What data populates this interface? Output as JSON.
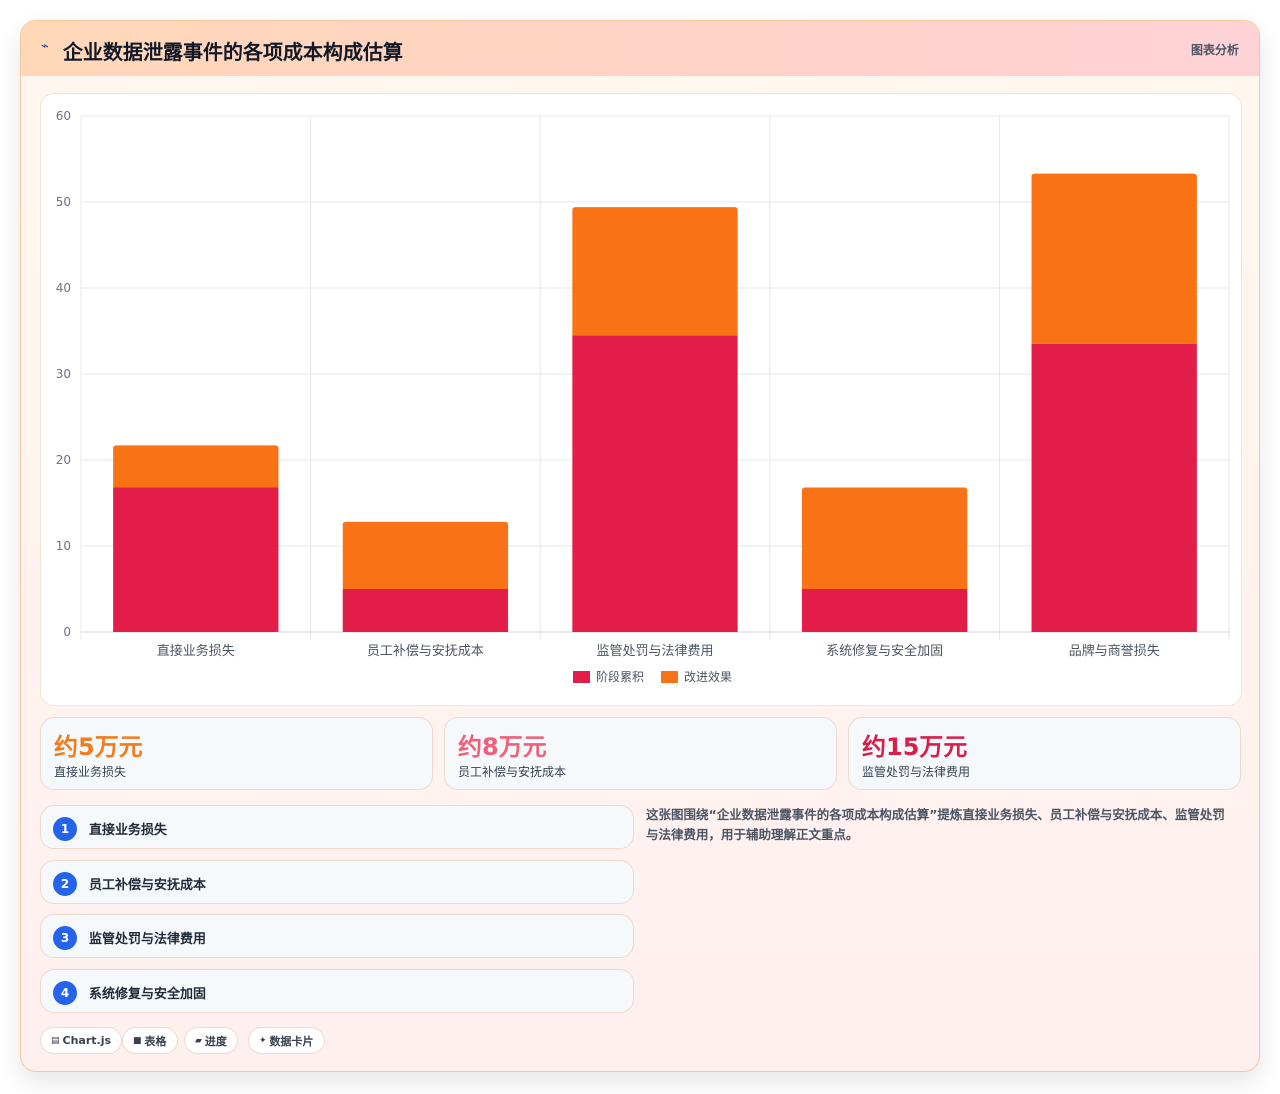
{
  "header": {
    "icon": "chart-icon",
    "title": "企业数据泄露事件的各项成本构成估算",
    "tag": "图表分析"
  },
  "chart_data": {
    "type": "bar",
    "stacked": true,
    "categories": [
      "直接业务损失",
      "员工补偿与安抚成本",
      "监管处罚与法律费用",
      "系统修复与安全加固",
      "品牌与商誉损失"
    ],
    "series": [
      {
        "name": "阶段累积",
        "values": [
          16.8,
          5,
          34.5,
          5,
          33.5
        ],
        "color": "#e11d48"
      },
      {
        "name": "改进效果",
        "values": [
          4.9,
          7.8,
          14.9,
          11.8,
          19.8
        ],
        "color": "#f97316"
      }
    ],
    "ylim": [
      0,
      60
    ],
    "yticks": [
      0,
      10,
      20,
      30,
      40,
      50,
      60
    ],
    "grid": true,
    "legend_position": "bottom"
  },
  "stats": [
    {
      "value": "约5万元",
      "label": "直接业务损失",
      "color": "#f07c1e"
    },
    {
      "value": "约8万元",
      "label": "员工补偿与安抚成本",
      "color": "#f0607a"
    },
    {
      "value": "约15万元",
      "label": "监管处罚与法律费用",
      "color": "#d91e4a"
    }
  ],
  "steps": [
    {
      "num": "1",
      "label": "直接业务损失"
    },
    {
      "num": "2",
      "label": "员工补偿与安抚成本"
    },
    {
      "num": "3",
      "label": "监管处罚与法律费用"
    },
    {
      "num": "4",
      "label": "系统修复与安全加固"
    }
  ],
  "description": "这张图围绕“企业数据泄露事件的各项成本构成估算”提炼直接业务损失、员工补偿与安抚成本、监管处罚与法律费用，用于辅助理解正文重点。",
  "chips": [
    {
      "icon": "▤",
      "label": "Chart.js"
    },
    {
      "icon": "■",
      "label": "表格"
    },
    {
      "icon": "▰",
      "label": "进度"
    },
    {
      "icon": "✦",
      "label": "数据卡片"
    }
  ]
}
